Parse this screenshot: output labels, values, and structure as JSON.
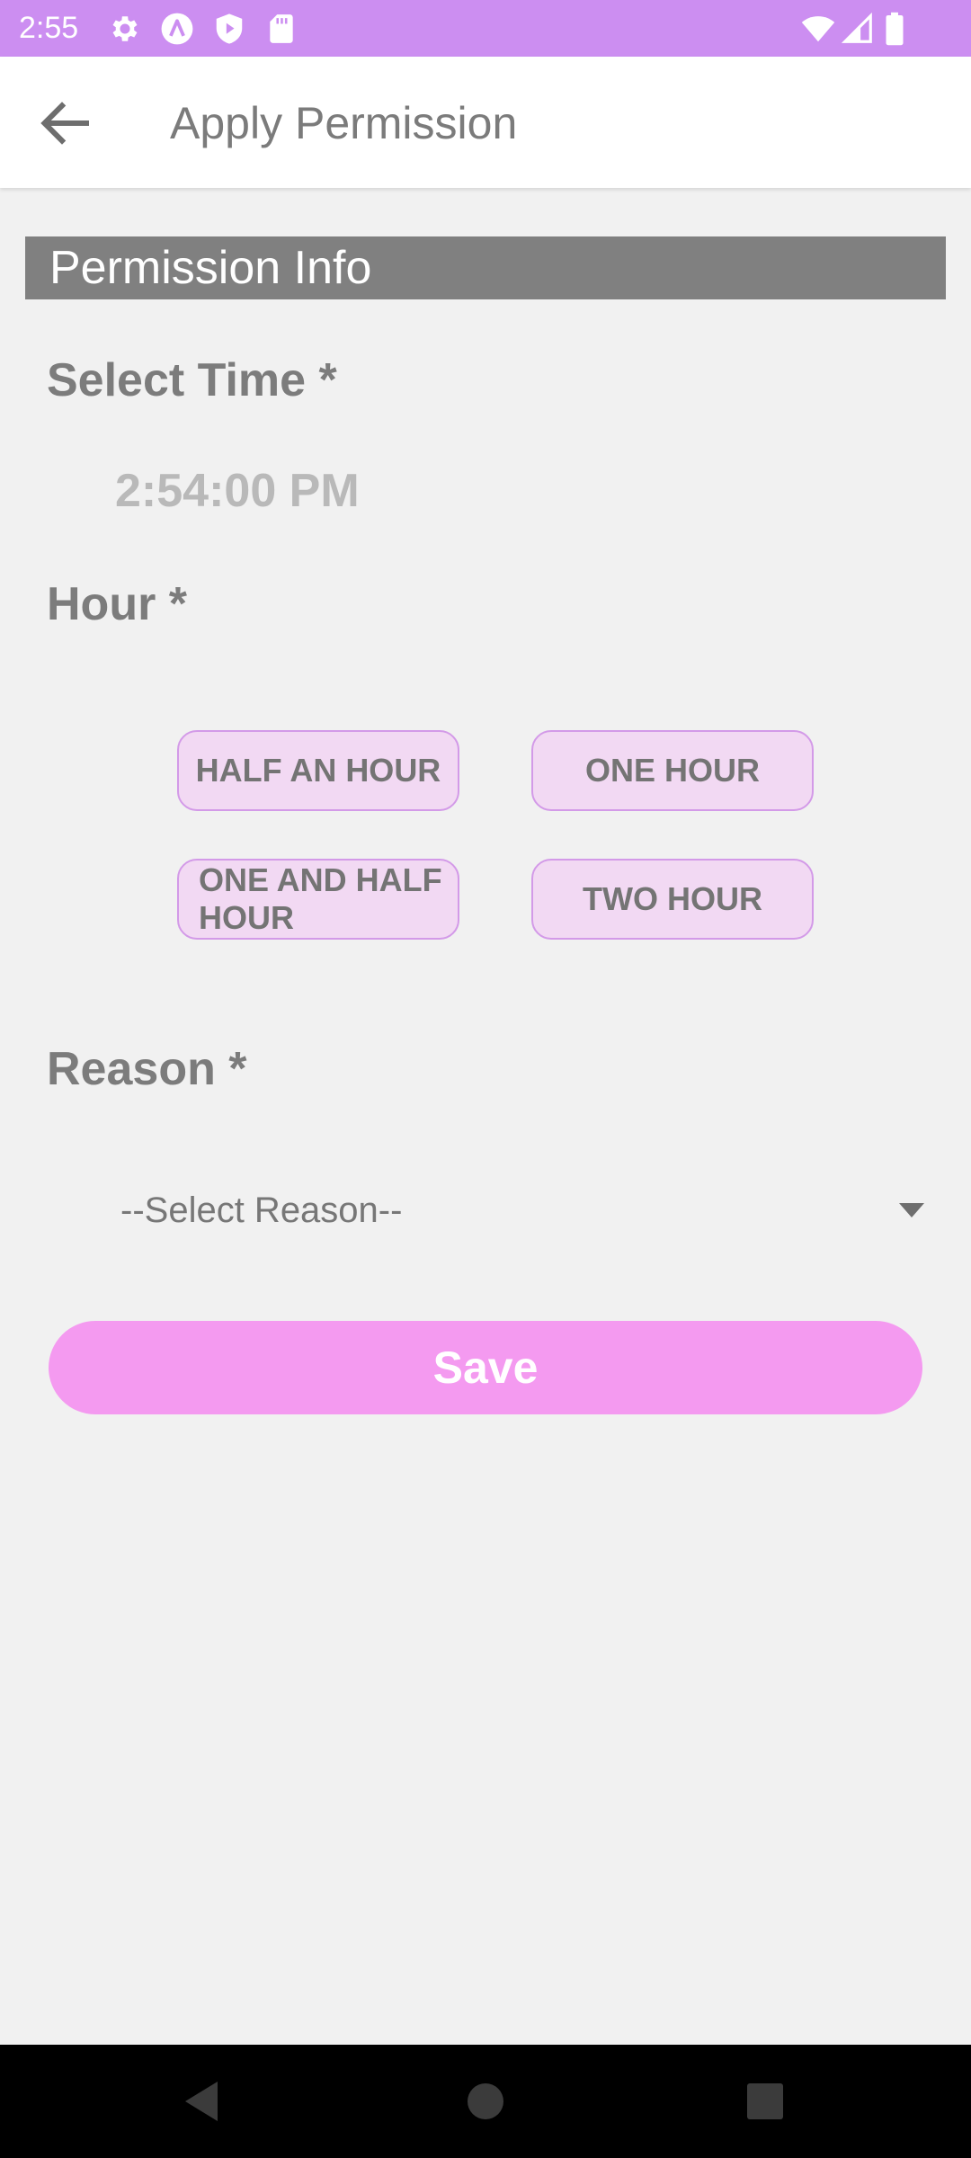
{
  "status_bar": {
    "time": "2:55",
    "left_icons": [
      "settings-icon",
      "font-app-icon",
      "play-protect-icon",
      "sd-card-icon"
    ],
    "right_icons": [
      "wifi-icon",
      "cell-signal-icon",
      "battery-icon"
    ],
    "color": "#cc8ef1"
  },
  "app_bar": {
    "back_icon": "arrow-back-icon",
    "title": "Apply Permission"
  },
  "section": {
    "header": "Permission Info"
  },
  "form": {
    "time_label": "Select Time *",
    "time_value": "2:54:00 PM",
    "hour_label": "Hour *",
    "hour_options": [
      "HALF AN HOUR",
      "ONE HOUR",
      "ONE AND HALF HOUR",
      "TWO HOUR"
    ],
    "reason_label": "Reason *",
    "reason_selected": "--Select Reason--",
    "save_label": "Save"
  },
  "colors": {
    "accent": "#cc8ef1",
    "chip_bg": "#f2d9f3",
    "save_bg": "#f49af0",
    "section_bg": "#808080"
  },
  "nav_bar": {
    "icons": [
      "nav-back-icon",
      "nav-home-icon",
      "nav-recents-icon"
    ]
  }
}
